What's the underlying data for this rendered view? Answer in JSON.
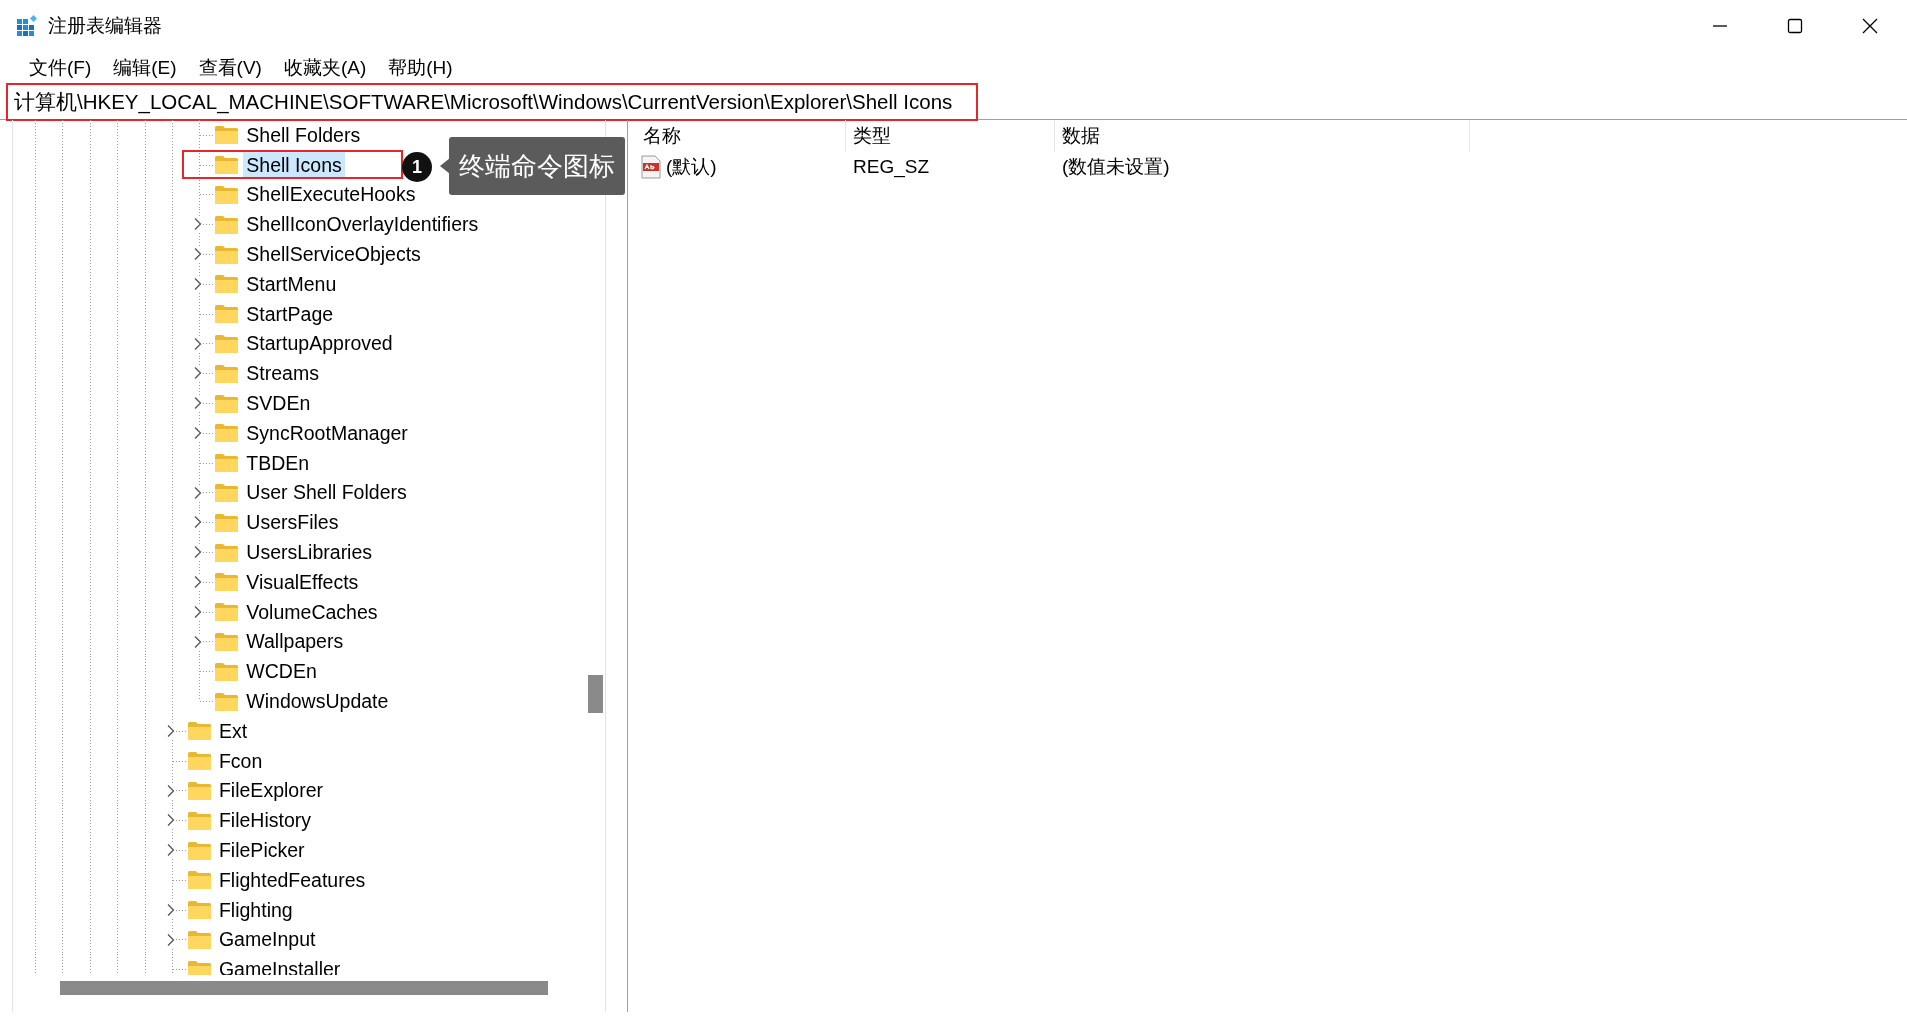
{
  "window": {
    "title": "注册表编辑器"
  },
  "menu": [
    "文件(F)",
    "编辑(E)",
    "查看(V)",
    "收藏夹(A)",
    "帮助(H)"
  ],
  "address": {
    "path": "计算机\\HKEY_LOCAL_MACHINE\\SOFTWARE\\Microsoft\\Windows\\CurrentVersion\\Explorer\\Shell Icons",
    "highlighted": true
  },
  "tree": {
    "items": [
      {
        "children": [
          {
            "label": "Shell Folders",
            "expandable": false,
            "selected": false,
            "highlighted": false
          },
          {
            "label": "Shell Icons",
            "expandable": false,
            "selected": true,
            "highlighted": true
          },
          {
            "label": "ShellExecuteHooks",
            "expandable": false,
            "selected": false,
            "highlighted": false
          },
          {
            "label": "ShellIconOverlayIdentifiers",
            "expandable": true,
            "selected": false,
            "highlighted": false
          },
          {
            "label": "ShellServiceObjects",
            "expandable": true,
            "selected": false,
            "highlighted": false
          },
          {
            "label": "StartMenu",
            "expandable": true,
            "selected": false,
            "highlighted": false
          },
          {
            "label": "StartPage",
            "expandable": false,
            "selected": false,
            "highlighted": false
          },
          {
            "label": "StartupApproved",
            "expandable": true,
            "selected": false,
            "highlighted": false
          },
          {
            "label": "Streams",
            "expandable": true,
            "selected": false,
            "highlighted": false
          },
          {
            "label": "SVDEn",
            "expandable": true,
            "selected": false,
            "highlighted": false
          },
          {
            "label": "SyncRootManager",
            "expandable": true,
            "selected": false,
            "highlighted": false
          },
          {
            "label": "TBDEn",
            "expandable": false,
            "selected": false,
            "highlighted": false
          },
          {
            "label": "User Shell Folders",
            "expandable": true,
            "selected": false,
            "highlighted": false
          },
          {
            "label": "UsersFiles",
            "expandable": true,
            "selected": false,
            "highlighted": false
          },
          {
            "label": "UsersLibraries",
            "expandable": true,
            "selected": false,
            "highlighted": false
          },
          {
            "label": "VisualEffects",
            "expandable": true,
            "selected": false,
            "highlighted": false
          },
          {
            "label": "VolumeCaches",
            "expandable": true,
            "selected": false,
            "highlighted": false
          },
          {
            "label": "Wallpapers",
            "expandable": true,
            "selected": false,
            "highlighted": false
          },
          {
            "label": "WCDEn",
            "expandable": false,
            "selected": false,
            "highlighted": false
          },
          {
            "label": "WindowsUpdate",
            "expandable": false,
            "selected": false,
            "highlighted": false
          }
        ]
      },
      {
        "label": "Ext",
        "expandable": true,
        "selected": false,
        "highlighted": false
      },
      {
        "label": "Fcon",
        "expandable": false,
        "selected": false,
        "highlighted": false
      },
      {
        "label": "FileExplorer",
        "expandable": true,
        "selected": false,
        "highlighted": false
      },
      {
        "label": "FileHistory",
        "expandable": true,
        "selected": false,
        "highlighted": false
      },
      {
        "label": "FilePicker",
        "expandable": true,
        "selected": false,
        "highlighted": false
      },
      {
        "label": "FlightedFeatures",
        "expandable": false,
        "selected": false,
        "highlighted": false
      },
      {
        "label": "Flighting",
        "expandable": true,
        "selected": false,
        "highlighted": false
      },
      {
        "label": "GameInput",
        "expandable": true,
        "selected": false,
        "highlighted": false
      },
      {
        "label": "GameInstaller",
        "expandable": false,
        "selected": false,
        "highlighted": false
      }
    ]
  },
  "values": {
    "columns": [
      "名称",
      "类型",
      "数据"
    ],
    "rows": [
      {
        "name": "(默认)",
        "type": "REG_SZ",
        "data": "(数值未设置)",
        "kind": "string"
      }
    ]
  },
  "callout": {
    "marker": "1",
    "text": "终端命令图标"
  }
}
